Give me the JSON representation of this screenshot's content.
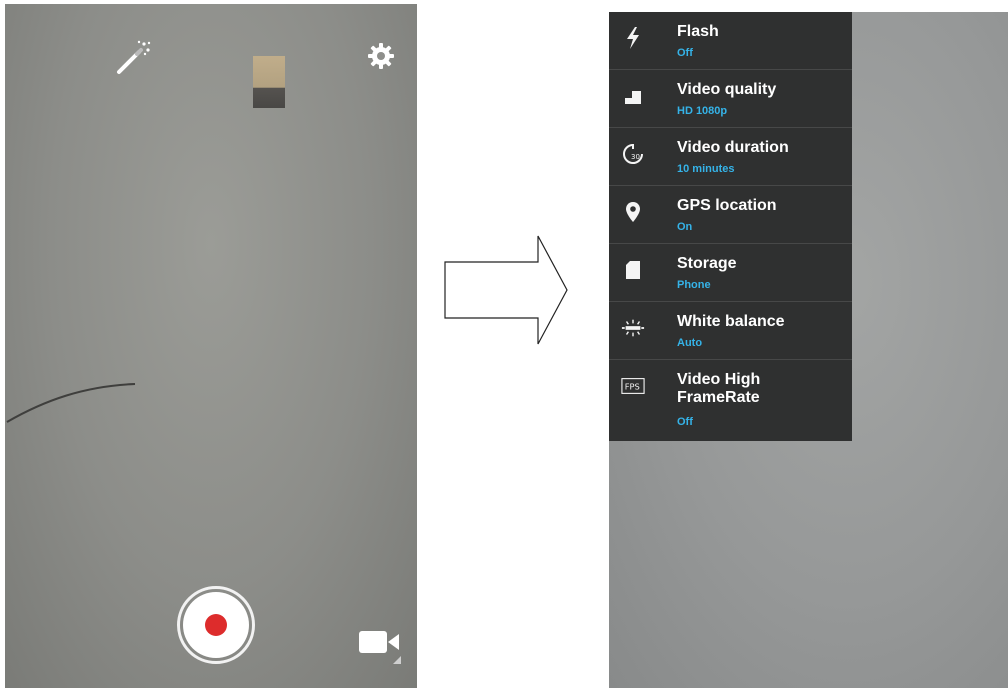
{
  "camera_view": {
    "effects_icon": "magic-wand-icon",
    "settings_icon": "gear-icon",
    "record_button_color": "#dd2c2c",
    "mode_icon": "video-camera-icon"
  },
  "transition_arrow": "right-arrow",
  "settings_menu": {
    "background": "#2f3030",
    "value_color": "#35b3e8",
    "items": [
      {
        "icon": "flash-icon",
        "title": "Flash",
        "value": "Off"
      },
      {
        "icon": "video-quality-icon",
        "title": "Video quality",
        "value": "HD 1080p"
      },
      {
        "icon": "timer-icon",
        "title": "Video duration",
        "value": "10 minutes"
      },
      {
        "icon": "location-pin-icon",
        "title": "GPS location",
        "value": "On"
      },
      {
        "icon": "sd-card-icon",
        "title": "Storage",
        "value": "Phone"
      },
      {
        "icon": "white-balance-icon",
        "title": "White balance",
        "value": "Auto"
      },
      {
        "icon": "fps-icon",
        "title": "Video High FrameRate",
        "value": "Off"
      }
    ]
  }
}
